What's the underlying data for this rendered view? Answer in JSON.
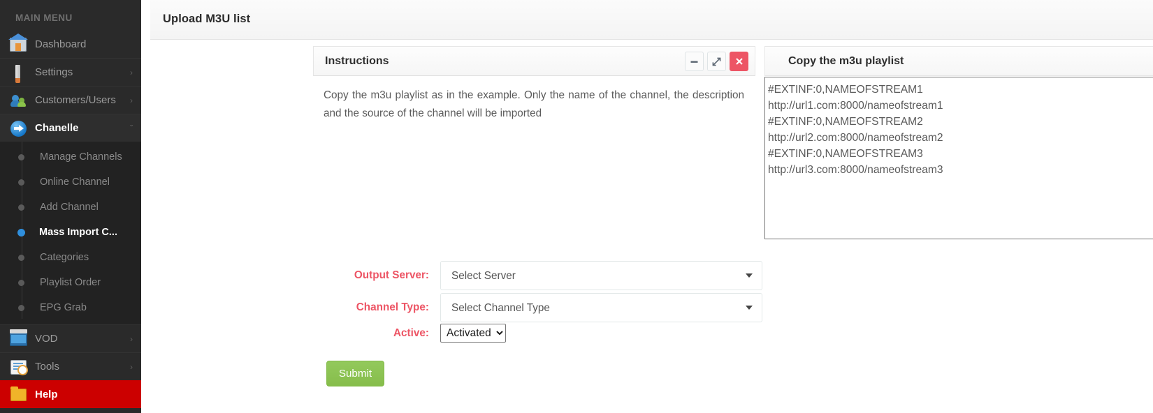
{
  "sidebar": {
    "menu_title": "MAIN MENU",
    "items": [
      {
        "label": "Dashboard",
        "icon": "home-icon",
        "caret": "",
        "active": false
      },
      {
        "label": "Settings",
        "icon": "screwdriver-icon",
        "caret": "›",
        "active": false
      },
      {
        "label": "Customers/Users",
        "icon": "users-icon",
        "caret": "›",
        "active": false
      },
      {
        "label": "Chanelle",
        "icon": "blue-arrow-icon",
        "caret": "ˇ",
        "active": true
      }
    ],
    "submenu": [
      {
        "label": "Manage Channels",
        "active": false
      },
      {
        "label": "Online Channel",
        "active": false
      },
      {
        "label": "Add Channel",
        "active": false
      },
      {
        "label": "Mass Import C...",
        "active": true
      },
      {
        "label": "Categories",
        "active": false
      },
      {
        "label": "Playlist Order",
        "active": false
      },
      {
        "label": "EPG Grab",
        "active": false
      }
    ],
    "items_bottom": [
      {
        "label": "VOD",
        "icon": "clapperboard-icon",
        "caret": "›",
        "active": false
      },
      {
        "label": "Tools",
        "icon": "tools-icon",
        "caret": "›",
        "active": false
      },
      {
        "label": "Help",
        "icon": "help-book-icon",
        "caret": "",
        "active": false
      }
    ]
  },
  "header": {
    "title": "Upload M3U list"
  },
  "instructions_panel": {
    "title": "Instructions",
    "body": "Copy the m3u playlist as in the example. Only the name of the channel, the description and the source of the channel will be imported",
    "tools": {
      "minimize": "minimize-icon",
      "expand": "expand-icon",
      "close": "close-icon"
    }
  },
  "copy_panel": {
    "title": "Copy the m3u playlist",
    "textarea_value": "#EXTINF:0,NAMEOFSTREAM1\nhttp://url1.com:8000/nameofstream1\n#EXTINF:0,NAMEOFSTREAM2\nhttp://url2.com:8000/nameofstream2\n#EXTINF:0,NAMEOFSTREAM3\nhttp://url3.com:8000/nameofstream3",
    "textarea_placeholder": ""
  },
  "form": {
    "output_server": {
      "label": "Output Server:",
      "value": "Select Server",
      "options": [
        "Select Server"
      ]
    },
    "channel_type": {
      "label": "Channel Type:",
      "value": "Select Channel Type",
      "options": [
        "Select Channel Type"
      ]
    },
    "active": {
      "label": "Active:",
      "value": "Activated",
      "options": [
        "Activated"
      ]
    },
    "submit_label": "Submit"
  },
  "colors": {
    "accent_red": "#ed5565",
    "submit_green": "#8cc152",
    "help_red": "#cc0000",
    "active_blue": "#2f8fdd",
    "sidebar_bg": "#2a2a2a"
  }
}
